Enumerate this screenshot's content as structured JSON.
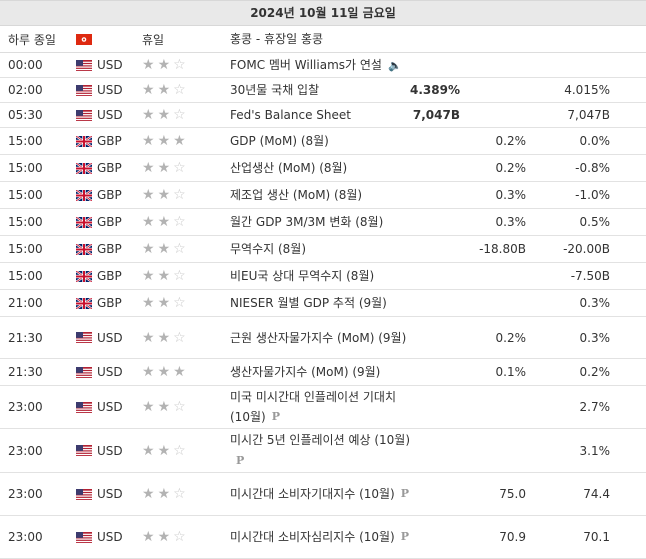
{
  "calendar": {
    "date_label": "2024년 10월 11일 금요일",
    "holiday": {
      "label": "하루 종일",
      "country": "HK",
      "type": "휴일",
      "name": "홍콩 - 휴장일 홍콩"
    },
    "rows": [
      {
        "time": "00:00",
        "flag": "US",
        "currency": "USD",
        "importance": 2,
        "event": "FOMC 멤버 Williams가 연설",
        "speech": true,
        "actual": "",
        "forecast": "",
        "previous": ""
      },
      {
        "time": "02:00",
        "flag": "US",
        "currency": "USD",
        "importance": 2,
        "event": "30년물 국채 입찰",
        "actual": "4.389%",
        "forecast": "",
        "previous": "4.015%"
      },
      {
        "time": "05:30",
        "flag": "US",
        "currency": "USD",
        "importance": 2,
        "event": "Fed's Balance Sheet",
        "actual": "7,047B",
        "forecast": "",
        "previous": "7,047B"
      },
      {
        "time": "15:00",
        "flag": "GB",
        "currency": "GBP",
        "importance": 3,
        "event": "GDP (MoM) (8월)",
        "actual": "",
        "forecast": "0.2%",
        "previous": "0.0%"
      },
      {
        "time": "15:00",
        "flag": "GB",
        "currency": "GBP",
        "importance": 2,
        "event": "산업생산 (MoM) (8월)",
        "actual": "",
        "forecast": "0.2%",
        "previous": "-0.8%"
      },
      {
        "time": "15:00",
        "flag": "GB",
        "currency": "GBP",
        "importance": 2,
        "event": "제조업 생산 (MoM) (8월)",
        "actual": "",
        "forecast": "0.3%",
        "previous": "-1.0%"
      },
      {
        "time": "15:00",
        "flag": "GB",
        "currency": "GBP",
        "importance": 2,
        "event": "월간 GDP 3M/3M 변화 (8월)",
        "actual": "",
        "forecast": "0.3%",
        "previous": "0.5%"
      },
      {
        "time": "15:00",
        "flag": "GB",
        "currency": "GBP",
        "importance": 2,
        "event": "무역수지 (8월)",
        "actual": "",
        "forecast": "-18.80B",
        "previous": "-20.00B"
      },
      {
        "time": "15:00",
        "flag": "GB",
        "currency": "GBP",
        "importance": 2,
        "event": "비EU국 상대 무역수지 (8월)",
        "actual": "",
        "forecast": "",
        "previous": "-7.50B"
      },
      {
        "time": "21:00",
        "flag": "GB",
        "currency": "GBP",
        "importance": 2,
        "event": "NIESER 월별 GDP 추적 (9월)",
        "actual": "",
        "forecast": "",
        "previous": "0.3%"
      },
      {
        "time": "21:30",
        "flag": "US",
        "currency": "USD",
        "importance": 2,
        "event": "근원 생산자물가지수 (MoM) (9월)",
        "actual": "",
        "forecast": "0.2%",
        "previous": "0.3%"
      },
      {
        "time": "21:30",
        "flag": "US",
        "currency": "USD",
        "importance": 3,
        "event": "생산자물가지수 (MoM) (9월)",
        "actual": "",
        "forecast": "0.1%",
        "previous": "0.2%"
      },
      {
        "time": "23:00",
        "flag": "US",
        "currency": "USD",
        "importance": 2,
        "event": "미국 미시간대 인플레이션 기대치 (10월)",
        "prelim": "P",
        "actual": "",
        "forecast": "",
        "previous": "2.7%"
      },
      {
        "time": "23:00",
        "flag": "US",
        "currency": "USD",
        "importance": 2,
        "event": "미시간 5년 인플레이션 예상 (10월)",
        "prelim": "P",
        "actual": "",
        "forecast": "",
        "previous": "3.1%"
      },
      {
        "time": "23:00",
        "flag": "US",
        "currency": "USD",
        "importance": 2,
        "event": "미시간대 소비자기대지수 (10월)",
        "prelim": "P",
        "actual": "",
        "forecast": "75.0",
        "previous": "74.4"
      },
      {
        "time": "23:00",
        "flag": "US",
        "currency": "USD",
        "importance": 2,
        "event": "미시간대 소비자심리지수 (10월)",
        "prelim": "P",
        "actual": "",
        "forecast": "70.9",
        "previous": "70.1"
      }
    ]
  },
  "colors": {
    "header_bg": "#e9e9e9",
    "star_on": "#b3b3b3",
    "star_off": "#d0d0d0"
  }
}
